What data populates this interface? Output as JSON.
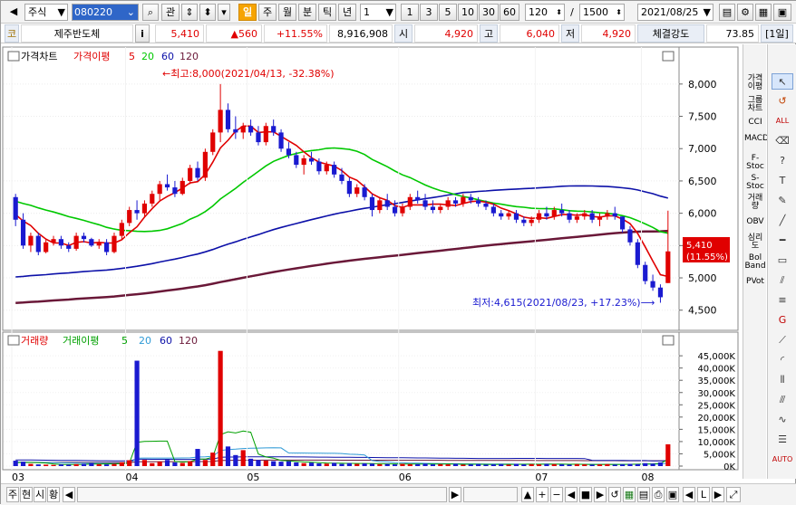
{
  "toolbar": {
    "market": "주식",
    "code": "080220",
    "btn_search": "⌕",
    "btn_gwan": "관",
    "periods": [
      "일",
      "주",
      "월",
      "분",
      "틱",
      "년"
    ],
    "interval_value": "1",
    "interval_buttons": [
      "1",
      "3",
      "5",
      "10",
      "30",
      "60"
    ],
    "count_value": "120",
    "separator": "/",
    "total_value": "1500",
    "date_value": "2021/08/25"
  },
  "infobar": {
    "code_badge": "코",
    "name": "제주반도체",
    "info_btn": "i",
    "price": "5,410",
    "change": "▲560",
    "change_pct": "+11.55%",
    "volume": "8,916,908",
    "open_label": "시",
    "open_value": "4,920",
    "high_label": "고",
    "high_value": "6,040",
    "low_label": "저",
    "low_value": "4,920",
    "strength_label": "체결강도",
    "strength_value": "73.85",
    "period_badge": "[1일]"
  },
  "price_panel": {
    "legend_title": "가격차트",
    "legend_ma_label": "가격이평",
    "legend_ma": [
      "5",
      "20",
      "60",
      "120"
    ],
    "max_annotation": "←최고:8,000(2021/04/13, -32.38%)",
    "min_annotation": "최저:4,615(2021/08/23, +17.23%)⟶",
    "last_price": "5,410",
    "last_pct": "(11.55%)"
  },
  "volume_panel": {
    "legend_title": "거래량",
    "legend_ma_label": "거래이평",
    "legend_ma": [
      "5",
      "20",
      "60",
      "120"
    ]
  },
  "chart_data": [
    {
      "type": "candlestick",
      "title": "가격차트",
      "x_ticks": [
        "03",
        "04",
        "05",
        "06",
        "07",
        "08"
      ],
      "y_ticks": [
        "8,000",
        "7,500",
        "7,000",
        "6,500",
        "6,000",
        "5,500",
        "5,000",
        "4,500"
      ],
      "ylim": [
        4300,
        8250
      ],
      "colors": {
        "up": "#e00000",
        "down": "#1a1ad0",
        "ma5": "#e00000",
        "ma20": "#00c800",
        "ma60": "#0c10a8",
        "ma120": "#6a1838"
      },
      "ohlc": [
        [
          6250,
          6300,
          5800,
          5900
        ],
        [
          5900,
          6000,
          5450,
          5500
        ],
        [
          5500,
          5700,
          5400,
          5650
        ],
        [
          5650,
          5700,
          5350,
          5400
        ],
        [
          5400,
          5600,
          5380,
          5550
        ],
        [
          5550,
          5650,
          5500,
          5600
        ],
        [
          5600,
          5650,
          5450,
          5500
        ],
        [
          5500,
          5550,
          5400,
          5450
        ],
        [
          5450,
          5700,
          5420,
          5650
        ],
        [
          5650,
          5700,
          5550,
          5600
        ],
        [
          5600,
          5620,
          5480,
          5500
        ],
        [
          5500,
          5600,
          5450,
          5550
        ],
        [
          5550,
          5600,
          5350,
          5400
        ],
        [
          5400,
          5700,
          5380,
          5650
        ],
        [
          5650,
          5900,
          5600,
          5850
        ],
        [
          5850,
          6100,
          5800,
          6050
        ],
        [
          6050,
          6200,
          5900,
          6000
        ],
        [
          6000,
          6200,
          5950,
          6150
        ],
        [
          6150,
          6350,
          6100,
          6300
        ],
        [
          6300,
          6500,
          6200,
          6450
        ],
        [
          6450,
          6600,
          6350,
          6400
        ],
        [
          6400,
          6500,
          6250,
          6300
        ],
        [
          6300,
          6550,
          6280,
          6500
        ],
        [
          6500,
          6750,
          6450,
          6700
        ],
        [
          6700,
          6800,
          6500,
          6550
        ],
        [
          6550,
          7000,
          6500,
          6950
        ],
        [
          6950,
          7300,
          6900,
          7250
        ],
        [
          7250,
          8000,
          7100,
          7600
        ],
        [
          7600,
          7700,
          7250,
          7300
        ],
        [
          7300,
          7500,
          7150,
          7250
        ],
        [
          7250,
          7400,
          7150,
          7350
        ],
        [
          7350,
          7450,
          7200,
          7250
        ],
        [
          7250,
          7350,
          7050,
          7100
        ],
        [
          7100,
          7400,
          7050,
          7350
        ],
        [
          7350,
          7450,
          7200,
          7250
        ],
        [
          7250,
          7300,
          6950,
          7000
        ],
        [
          7000,
          7100,
          6850,
          6900
        ],
        [
          6900,
          6950,
          6700,
          6750
        ],
        [
          6750,
          6900,
          6600,
          6850
        ],
        [
          6850,
          6950,
          6750,
          6800
        ],
        [
          6800,
          6850,
          6600,
          6650
        ],
        [
          6650,
          6800,
          6600,
          6750
        ],
        [
          6750,
          6800,
          6550,
          6600
        ],
        [
          6600,
          6700,
          6450,
          6500
        ],
        [
          6500,
          6550,
          6250,
          6300
        ],
        [
          6300,
          6450,
          6250,
          6400
        ],
        [
          6400,
          6450,
          6200,
          6250
        ],
        [
          6250,
          6300,
          5950,
          6050
        ],
        [
          6050,
          6250,
          6000,
          6200
        ],
        [
          6200,
          6300,
          6050,
          6100
        ],
        [
          6100,
          6200,
          5950,
          6000
        ],
        [
          6000,
          6150,
          5950,
          6100
        ],
        [
          6100,
          6300,
          6050,
          6250
        ],
        [
          6250,
          6350,
          6150,
          6200
        ],
        [
          6200,
          6300,
          6050,
          6100
        ],
        [
          6100,
          6200,
          6000,
          6050
        ],
        [
          6050,
          6150,
          6000,
          6100
        ],
        [
          6100,
          6250,
          6050,
          6200
        ],
        [
          6200,
          6250,
          6100,
          6150
        ],
        [
          6150,
          6300,
          6100,
          6250
        ],
        [
          6250,
          6300,
          6150,
          6200
        ],
        [
          6200,
          6250,
          6100,
          6150
        ],
        [
          6150,
          6200,
          6050,
          6100
        ],
        [
          6100,
          6150,
          5950,
          6000
        ],
        [
          6000,
          6050,
          5900,
          5950
        ],
        [
          5950,
          6050,
          5900,
          6000
        ],
        [
          6000,
          6050,
          5850,
          5900
        ],
        [
          5900,
          5950,
          5800,
          5850
        ],
        [
          5850,
          5950,
          5800,
          5900
        ],
        [
          5900,
          6050,
          5850,
          6000
        ],
        [
          6000,
          6100,
          5900,
          5950
        ],
        [
          5950,
          6100,
          5900,
          6050
        ],
        [
          6050,
          6150,
          5950,
          6000
        ],
        [
          6000,
          6050,
          5850,
          5900
        ],
        [
          5900,
          6000,
          5850,
          5950
        ],
        [
          5950,
          6050,
          5900,
          6000
        ],
        [
          6000,
          6050,
          5850,
          5900
        ],
        [
          5900,
          6000,
          5800,
          5950
        ],
        [
          5950,
          6050,
          5900,
          6000
        ],
        [
          6000,
          6100,
          5900,
          5950
        ],
        [
          5950,
          5950,
          5700,
          5750
        ],
        [
          5750,
          5800,
          5500,
          5550
        ],
        [
          5550,
          5600,
          5150,
          5200
        ],
        [
          5200,
          5250,
          4900,
          4950
        ],
        [
          4950,
          5050,
          4800,
          4850
        ],
        [
          4850,
          4900,
          4615,
          4700
        ],
        [
          4920,
          6040,
          4920,
          5410
        ]
      ]
    },
    {
      "type": "bar",
      "title": "거래량",
      "y_ticks": [
        "45,000K",
        "40,000K",
        "35,000K",
        "30,000K",
        "25,000K",
        "20,000K",
        "15,000K",
        "10,000K",
        "5,000K",
        "0K"
      ],
      "ylim": [
        0,
        48000
      ],
      "volumes_k": [
        2200,
        1800,
        900,
        700,
        600,
        500,
        700,
        600,
        800,
        900,
        1200,
        800,
        700,
        900,
        1500,
        2400,
        43000,
        2500,
        1200,
        1800,
        2500,
        1500,
        1300,
        2000,
        7000,
        2500,
        5500,
        47000,
        8000,
        4500,
        6500,
        3000,
        2500,
        2200,
        2000,
        1800,
        2000,
        1500,
        1200,
        1400,
        1100,
        1000,
        1300,
        900,
        1200,
        900,
        1100,
        1000,
        800,
        900,
        700,
        900,
        800,
        800,
        1000,
        700,
        800,
        700,
        900,
        600,
        700,
        800,
        600,
        700,
        800,
        600,
        900,
        700,
        800,
        700,
        900,
        800,
        700,
        600,
        800,
        700,
        600,
        700,
        800,
        600,
        700,
        900,
        800,
        1200,
        1000,
        1500,
        8900
      ]
    }
  ],
  "right_toolbar": {
    "indicators": [
      "가격이평",
      "그룹차트",
      "CCI",
      "MACD",
      "F-Stoc",
      "S-Stoc",
      "거래량",
      "OBV",
      "심리도",
      "Bol Band",
      "PVot"
    ]
  },
  "bottom": {
    "buttons": [
      "주",
      "현",
      "시",
      "황"
    ]
  }
}
